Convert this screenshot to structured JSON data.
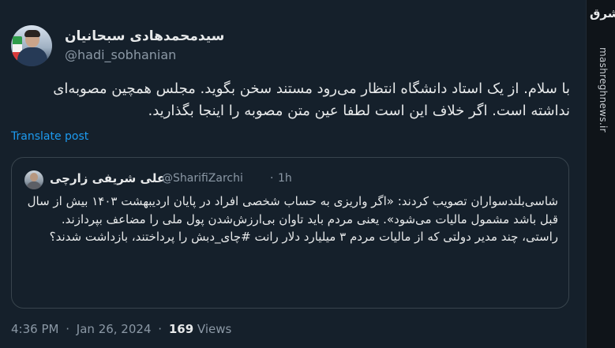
{
  "sidebar": {
    "logo": "مشرق",
    "url": "mashreghnews.ir"
  },
  "tweet": {
    "author": {
      "display_name": "سیدمحمدهادی سبحانیان",
      "handle": "@hadi_sobhanian"
    },
    "text": "با سلام. از یک استاد دانشگاه انتظار می‌رود مستند سخن بگوید. مجلس همچین مصوبه‌ای نداشته است. اگر خلاف این است لطفا عین متن مصوبه را اینجا بگذارید.",
    "translate_label": "Translate post",
    "quoted": {
      "author": {
        "display_name": "علی شریفی زارچی",
        "handle": "@SharifiZarchi",
        "separator": "·",
        "time": "1h"
      },
      "text": "شاسی‌بلندسواران تصویب کردند: «اگر واریزی به حساب شخصی افراد در پایان اردیبهشت ۱۴۰۳ بیش از سال قبل باشد مشمول مالیات می‌شود». یعنی مردم باید تاوان بی‌ارزش‌شدن پول ملی را مضاعف بپردازند.\nراستی، چند مدیر دولتی که از مالیات مردم ۳ میلیارد دلار رانت #چای_دبش را پرداختند، بازداشت شدند؟"
    },
    "meta": {
      "time": "4:36 PM",
      "date": "Jan 26, 2024",
      "separator": "·",
      "views_count": "169",
      "views_label": "Views"
    }
  }
}
